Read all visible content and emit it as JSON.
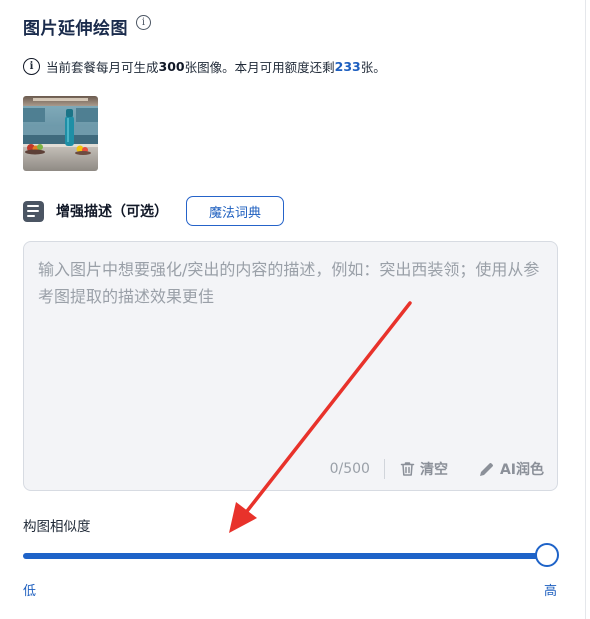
{
  "title": "图片延伸绘图",
  "title_info_icon": "info-icon",
  "notice": {
    "icon": "info-circle-icon",
    "prefix": "当前套餐每月可生成",
    "monthly_quota": "300",
    "middle": "张图像。本月可用额度还剩",
    "remaining_quota": "233",
    "suffix": "张。"
  },
  "reference_image": {
    "icon": "kitchen-bottle-thumbnail"
  },
  "enhance": {
    "icon": "text-lines-icon",
    "label": "增强描述（可选）",
    "magic_button": "魔法词典"
  },
  "description": {
    "value": "",
    "placeholder": "输入图片中想要强化/突出的内容的描述，例如：突出西装领；使用从参考图提取的描述效果更佳",
    "counter": "0/500",
    "clear_label": "清空",
    "clear_icon": "trash-icon",
    "polish_label": "AI润色",
    "polish_icon": "pencil-icon"
  },
  "similarity": {
    "label": "构图相似度",
    "value_fraction": 1.0,
    "low_label": "低",
    "high_label": "高"
  },
  "colors": {
    "accent": "#1e63c8",
    "annotation_arrow": "#e8322b"
  }
}
